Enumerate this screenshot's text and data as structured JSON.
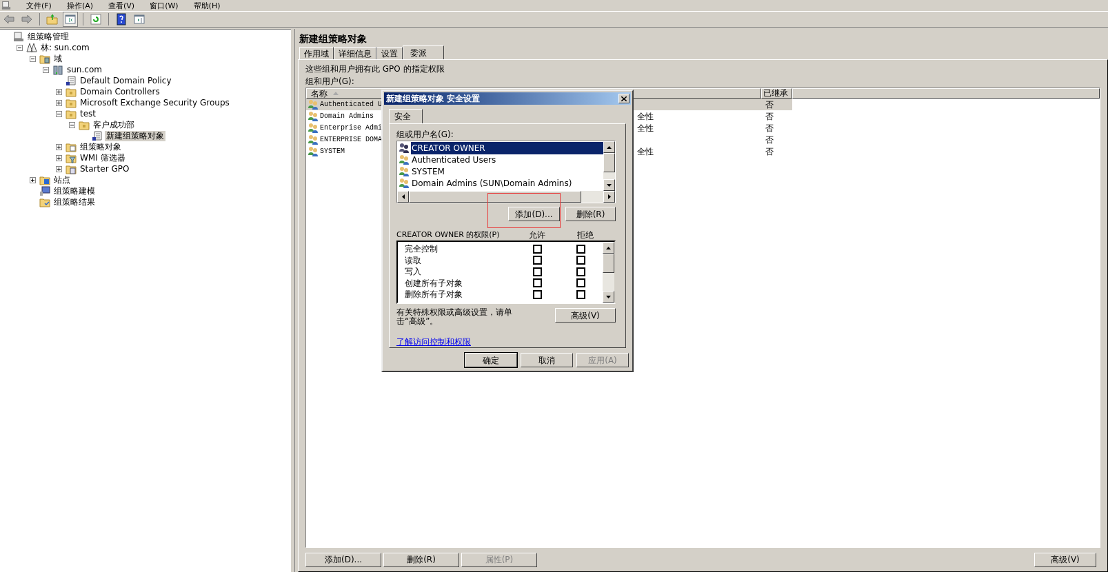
{
  "menu": [
    "文件(F)",
    "操作(A)",
    "查看(V)",
    "窗口(W)",
    "帮助(H)"
  ],
  "toolbar": [
    {
      "kind": "back",
      "pressed": false
    },
    {
      "kind": "forward",
      "pressed": false
    },
    {
      "kind": "sep"
    },
    {
      "kind": "up",
      "pressed": false
    },
    {
      "kind": "tree",
      "pressed": true
    },
    {
      "kind": "sep"
    },
    {
      "kind": "refresh",
      "pressed": false
    },
    {
      "kind": "sep"
    },
    {
      "kind": "help",
      "pressed": false
    },
    {
      "kind": "pane",
      "pressed": false
    }
  ],
  "tree": [
    {
      "label": "组策略管理",
      "kind": "console",
      "selected": false,
      "children": [
        {
          "label": "林: sun.com",
          "kind": "forest",
          "expanded": true,
          "selected": false,
          "children": [
            {
              "label": "域",
              "kind": "domains",
              "expanded": true,
              "selected": false,
              "children": [
                {
                  "label": "sun.com",
                  "kind": "domain",
                  "expanded": true,
                  "selected": false,
                  "children": [
                    {
                      "label": "Default Domain Policy",
                      "kind": "gpo",
                      "selected": false
                    },
                    {
                      "label": "Domain Controllers",
                      "kind": "ou",
                      "expanded": false,
                      "selected": false
                    },
                    {
                      "label": "Microsoft Exchange Security Groups",
                      "kind": "ou",
                      "expanded": false,
                      "selected": false
                    },
                    {
                      "label": "test",
                      "kind": "ou",
                      "expanded": true,
                      "selected": false,
                      "children": [
                        {
                          "label": "客户成功部",
                          "kind": "ou",
                          "expanded": true,
                          "selected": false,
                          "children": [
                            {
                              "label": "新建组策略对象",
                              "kind": "gpo",
                              "selected": true
                            }
                          ]
                        }
                      ]
                    },
                    {
                      "label": "组策略对象",
                      "kind": "gpofolder",
                      "expanded": false,
                      "selected": false
                    },
                    {
                      "label": "WMI 筛选器",
                      "kind": "wmi",
                      "expanded": false,
                      "selected": false
                    },
                    {
                      "label": "Starter GPO",
                      "kind": "starter",
                      "expanded": false,
                      "selected": false
                    }
                  ]
                }
              ]
            },
            {
              "label": "站点",
              "kind": "sites",
              "expanded": false,
              "selected": false
            },
            {
              "label": "组策略建模",
              "kind": "modeling",
              "selected": false
            },
            {
              "label": "组策略结果",
              "kind": "results",
              "selected": false
            }
          ]
        }
      ]
    }
  ],
  "details": {
    "title": "新建组策略对象",
    "tabs": [
      {
        "label": "作用域",
        "selected": false
      },
      {
        "label": "详细信息",
        "selected": false
      },
      {
        "label": "设置",
        "selected": false
      },
      {
        "label": "委派",
        "selected": true
      }
    ],
    "description": "这些组和用户拥有此 GPO 的指定权限",
    "list_label": "组和用户(G):",
    "columns": [
      "名称",
      "已继承"
    ],
    "rows": [
      {
        "name": "Authenticated U",
        "column_2": null,
        "inherited": "否",
        "selected": true
      },
      {
        "name": "Domain Admins",
        "column_2": "全性",
        "inherited": "否",
        "selected": false
      },
      {
        "name": "Enterprise Admi",
        "column_2": "全性",
        "inherited": "否",
        "selected": false
      },
      {
        "name": "ENTERPRISE DOMA",
        "column_2": null,
        "inherited": "否",
        "selected": false
      },
      {
        "name": "SYSTEM",
        "column_2": "全性",
        "inherited": "否",
        "selected": false
      }
    ],
    "buttons": [
      {
        "label": "添加(D)...",
        "disabled": false
      },
      {
        "label": "删除(R)",
        "disabled": false
      },
      {
        "label": "属性(P)",
        "disabled": true
      }
    ],
    "advanced_button": "高级(V)"
  },
  "dialog": {
    "title": "新建组策略对象 安全设置",
    "tab": "安全",
    "users_label": "组或用户名(G):",
    "users": [
      {
        "name": "CREATOR OWNER",
        "kind": "special",
        "selected": true
      },
      {
        "name": "Authenticated Users",
        "kind": "group",
        "selected": false
      },
      {
        "name": "SYSTEM",
        "kind": "group",
        "selected": false
      },
      {
        "name": "Domain Admins (SUN\\Domain Admins)",
        "kind": "group",
        "selected": false
      }
    ],
    "add_button": "添加(D)...",
    "remove_button": "删除(R)",
    "permissions_label": "CREATOR OWNER 的权限(P)",
    "allow_label": "允许",
    "deny_label": "拒绝",
    "permissions": [
      {
        "name": "完全控制",
        "allow": false,
        "deny": false
      },
      {
        "name": "读取",
        "allow": false,
        "deny": false
      },
      {
        "name": "写入",
        "allow": false,
        "deny": false
      },
      {
        "name": "创建所有子对象",
        "allow": false,
        "deny": false
      },
      {
        "name": "删除所有子对象",
        "allow": false,
        "deny": false
      }
    ],
    "advanced_hint": "有关特殊权限或高级设置，请单击“高级”。",
    "advanced_button": "高级(V)",
    "link": "了解访问控制和权限",
    "buttons": [
      {
        "label": "确定",
        "kind": "default",
        "disabled": false
      },
      {
        "label": "取消",
        "kind": "normal",
        "disabled": false
      },
      {
        "label": "应用(A)",
        "kind": "normal",
        "disabled": true
      }
    ]
  }
}
